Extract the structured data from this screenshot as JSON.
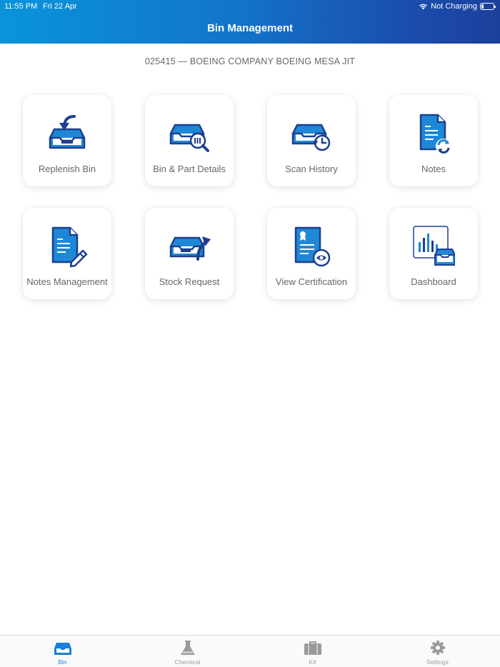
{
  "status": {
    "time": "11:55 PM",
    "date": "Fri 22 Apr",
    "charging": "Not Charging"
  },
  "header": {
    "title": "Bin Management"
  },
  "customer": "025415 — BOEING COMPANY BOEING MESA JIT",
  "tiles": [
    {
      "label": "Replenish Bin",
      "icon": "replenish-bin-icon"
    },
    {
      "label": "Bin & Part Details",
      "icon": "bin-search-icon"
    },
    {
      "label": "Scan History",
      "icon": "bin-history-icon"
    },
    {
      "label": "Notes",
      "icon": "notes-sync-icon"
    },
    {
      "label": "Notes Management",
      "icon": "notes-edit-icon"
    },
    {
      "label": "Stock Request",
      "icon": "bin-forward-icon"
    },
    {
      "label": "View Certification",
      "icon": "certificate-view-icon"
    },
    {
      "label": "Dashboard",
      "icon": "dashboard-chart-icon"
    }
  ],
  "tabs": [
    {
      "label": "Bin",
      "icon": "bin-tab-icon",
      "active": true
    },
    {
      "label": "Chemical",
      "icon": "flask-icon",
      "active": false
    },
    {
      "label": "Kit",
      "icon": "briefcase-icon",
      "active": false
    },
    {
      "label": "Settings",
      "icon": "gear-icon",
      "active": false
    }
  ],
  "colors": {
    "header_start": "#0a93db",
    "header_end": "#1d3f9c",
    "icon_blue": "#1e88d6",
    "icon_navy": "#1d3f8f",
    "tab_active": "#1a7fdc",
    "tab_inactive": "#9a9a9a"
  }
}
